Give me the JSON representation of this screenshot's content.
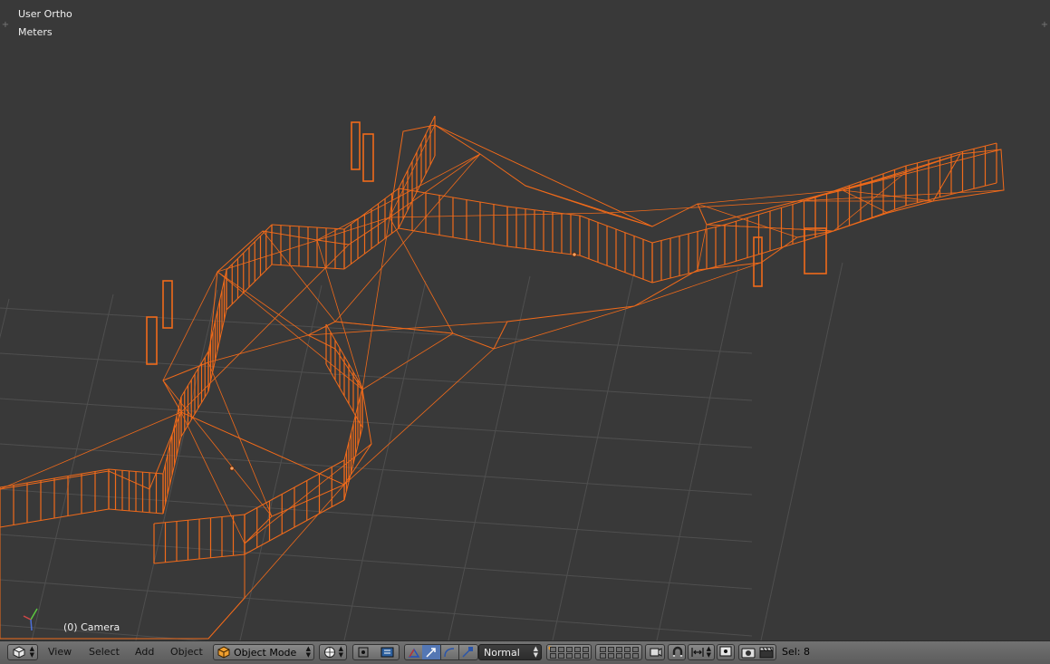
{
  "viewport": {
    "view_name": "User Ortho",
    "units": "Meters",
    "active_object": "(0) Camera"
  },
  "header": {
    "editor_type_icon": "cube-icon",
    "menus": {
      "view": "View",
      "select": "Select",
      "add": "Add",
      "object": "Object"
    },
    "mode": {
      "label": "Object Mode",
      "icon": "object-cube-icon"
    },
    "shading_icon": "sphere-shading-icon",
    "pivot_icon": "pivot-point-icon",
    "manipulator_icons": [
      "manipulator-toggle-icon",
      "translate-icon",
      "rotate-icon",
      "scale-icon"
    ],
    "orientation": "Normal",
    "layers_icon": "layers-icon",
    "lock_icon": "lock-camera-icon",
    "snap_icon": "magnet-icon",
    "snap_target_icon": "snap-element-icon",
    "proportional_icon": "proportional-edit-icon",
    "render_icon": "render-camera-icon",
    "anim_icon": "clapboard-icon",
    "status": "Sel: 8"
  },
  "colors": {
    "viewport_bg": "#393939",
    "grid": "#4f4f4f",
    "wire_selected": "#f06a1a",
    "header_bg": "#666666"
  }
}
